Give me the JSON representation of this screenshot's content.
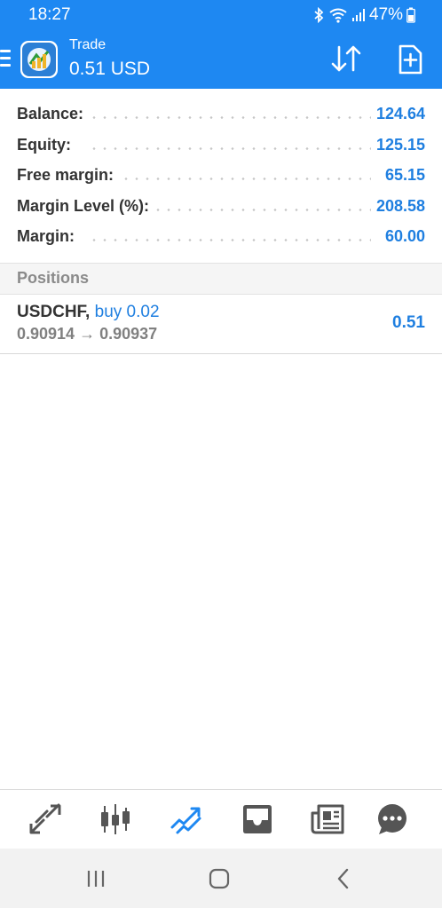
{
  "status_bar": {
    "time": "18:27",
    "battery": "47%",
    "icons": [
      "bluetooth-icon",
      "wifi-icon",
      "signal-icon",
      "battery-icon"
    ]
  },
  "app_bar": {
    "title": "Trade",
    "subtitle": "0.51 USD",
    "icons": [
      "menu-icon",
      "app-logo",
      "sort-icon",
      "new-order-icon"
    ]
  },
  "summary": [
    {
      "label": "Balance:",
      "value": "124.64"
    },
    {
      "label": "Equity:",
      "value": "125.15"
    },
    {
      "label": "Free margin:",
      "value": "65.15"
    },
    {
      "label": "Margin Level (%):",
      "value": "208.58"
    },
    {
      "label": "Margin:",
      "value": "60.00"
    }
  ],
  "positions": {
    "header": "Positions",
    "items": [
      {
        "symbol": "USDCHF,",
        "type": "buy 0.02",
        "prices": "0.90914 → 0.90937",
        "profit": "0.51"
      }
    ]
  },
  "bottom_nav": {
    "items": [
      "quotes-icon",
      "chart-icon",
      "trade-icon",
      "history-icon",
      "news-icon",
      "chat-icon"
    ],
    "active": "trade-icon"
  },
  "colors": {
    "primary": "#1e88f2",
    "value_blue": "#1f7fe0",
    "label_dark": "#333333",
    "muted": "#808080"
  }
}
